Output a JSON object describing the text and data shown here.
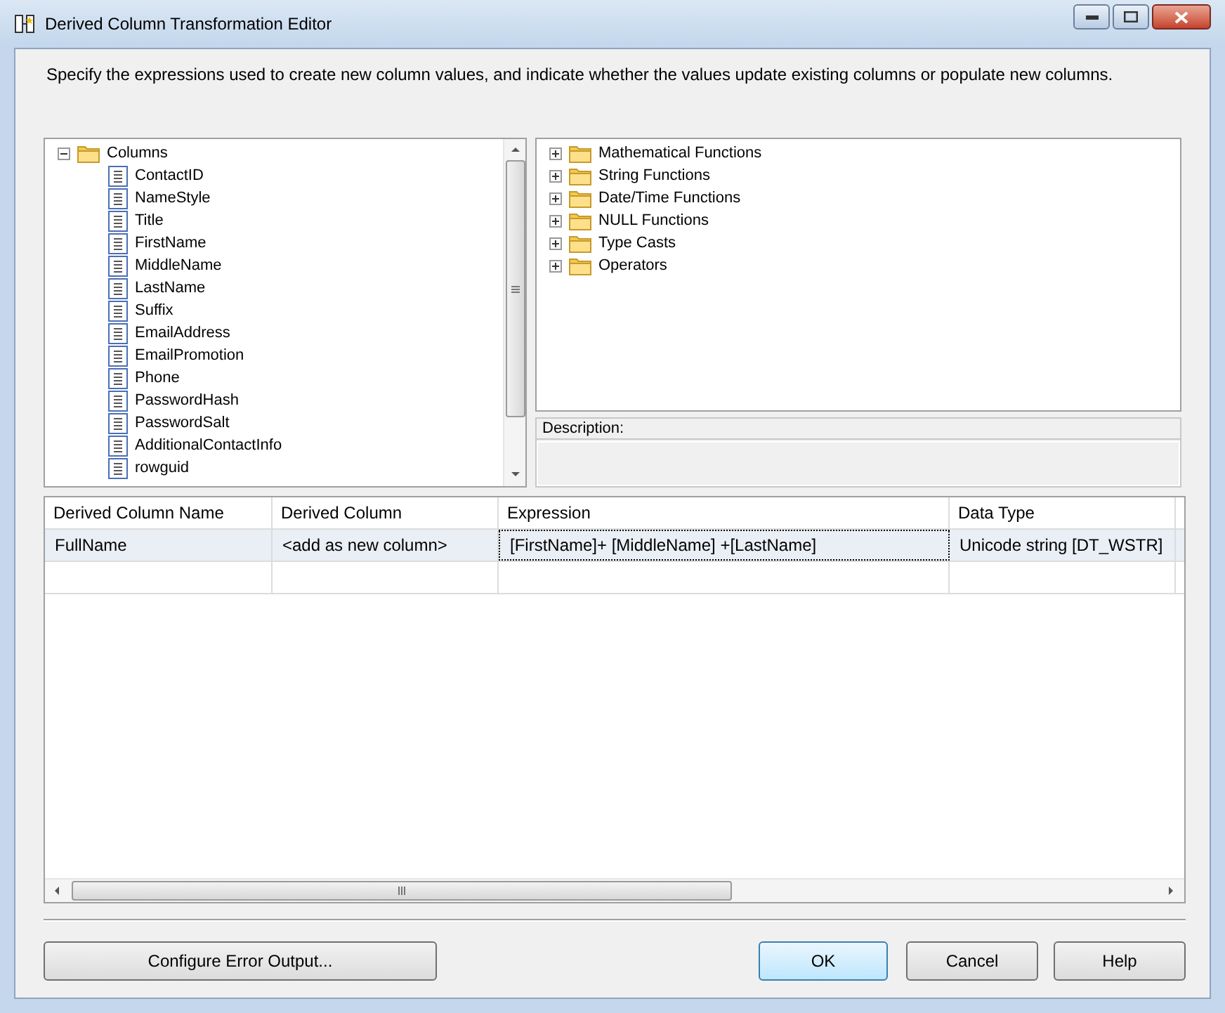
{
  "window": {
    "title": "Derived Column Transformation Editor"
  },
  "instructions": "Specify the expressions used to create new column values, and indicate whether the values update existing columns or populate new columns.",
  "columns_tree": {
    "label": "Columns",
    "expanded": true,
    "children": [
      "ContactID",
      "NameStyle",
      "Title",
      "FirstName",
      "MiddleName",
      "LastName",
      "Suffix",
      "EmailAddress",
      "EmailPromotion",
      "Phone",
      "PasswordHash",
      "PasswordSalt",
      "AdditionalContactInfo",
      "rowguid"
    ]
  },
  "functions_tree": [
    {
      "label": "Mathematical Functions",
      "expanded": false
    },
    {
      "label": "String Functions",
      "expanded": false
    },
    {
      "label": "Date/Time Functions",
      "expanded": false
    },
    {
      "label": "NULL Functions",
      "expanded": false
    },
    {
      "label": "Type Casts",
      "expanded": false
    },
    {
      "label": "Operators",
      "expanded": false
    }
  ],
  "description": {
    "label": "Description:"
  },
  "grid": {
    "columns": [
      "Derived Column Name",
      "Derived Column",
      "Expression",
      "Data Type"
    ],
    "rows": [
      {
        "selected": true,
        "cells": [
          {
            "text": "FullName",
            "focused": false
          },
          {
            "text": "<add as new column>",
            "focused": false
          },
          {
            "text": "[FirstName]+ [MiddleName] +[LastName]",
            "focused": true
          },
          {
            "text": "Unicode string [DT_WSTR]",
            "focused": false
          }
        ]
      }
    ]
  },
  "buttons": {
    "configure": "Configure Error Output...",
    "ok": "OK",
    "cancel": "Cancel",
    "help": "Help"
  }
}
